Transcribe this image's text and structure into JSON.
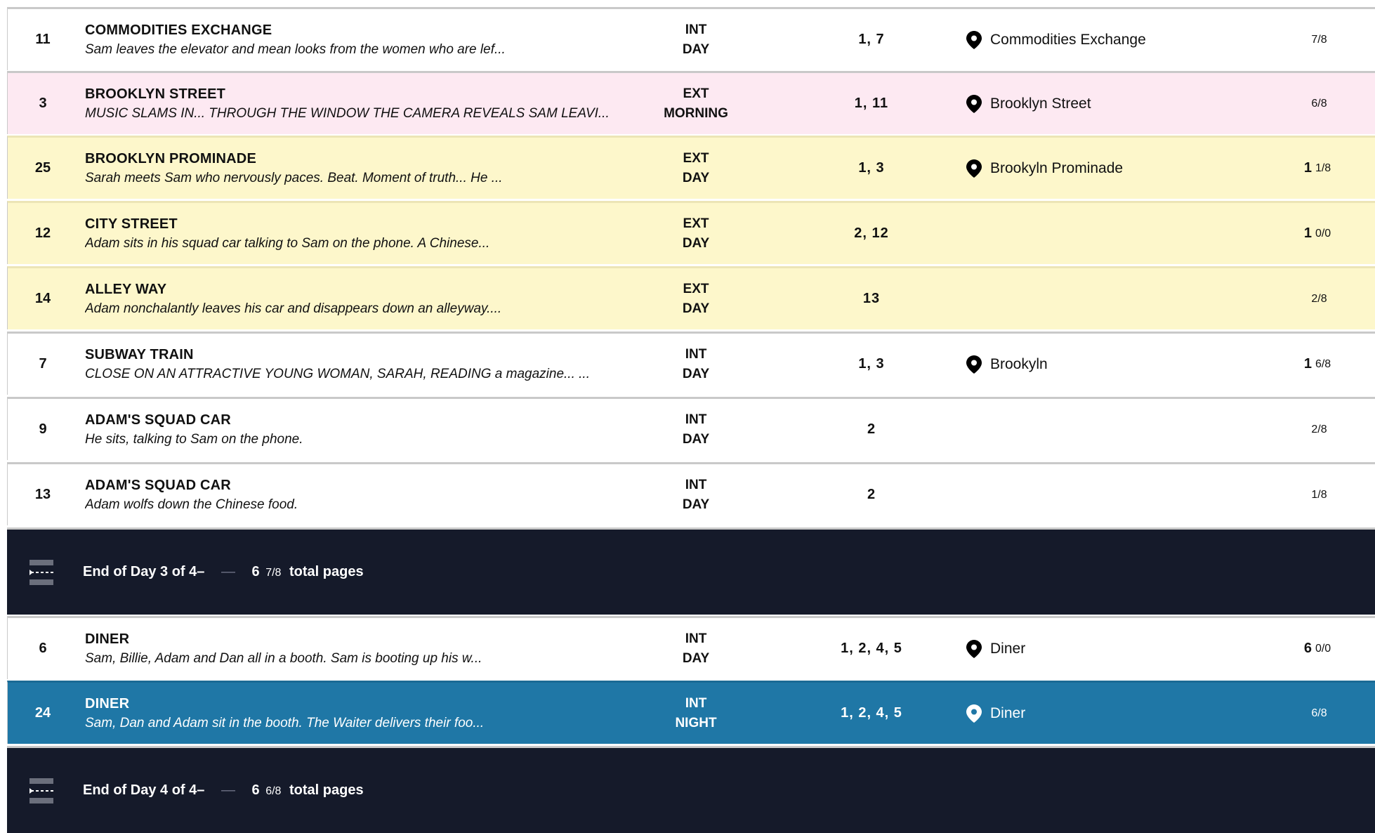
{
  "strips": [
    {
      "scene": "11",
      "heading": "COMMODITIES EXCHANGE",
      "synopsis": "Sam leaves the elevator and mean looks from the women who are lef...",
      "int_ext": "INT",
      "time": "DAY",
      "cast": "1, 7",
      "location": "Commodities Exchange",
      "pages_whole": "",
      "pages_frac": "7/8",
      "color": "white"
    },
    {
      "scene": "3",
      "heading": "BROOKLYN STREET",
      "synopsis": "MUSIC SLAMS IN... THROUGH THE WINDOW THE CAMERA REVEALS SAM LEAVI...",
      "int_ext": "EXT",
      "time": "MORNING",
      "cast": "1, 11",
      "location": "Brooklyn Street",
      "pages_whole": "",
      "pages_frac": "6/8",
      "color": "pink"
    },
    {
      "scene": "25",
      "heading": "BROOKLYN PROMINADE",
      "synopsis": "Sarah meets Sam who nervously paces. Beat. Moment of truth... He ...",
      "int_ext": "EXT",
      "time": "DAY",
      "cast": "1, 3",
      "location": "Brookyln Prominade",
      "pages_whole": "1",
      "pages_frac": "1/8",
      "color": "yellow"
    },
    {
      "scene": "12",
      "heading": "CITY STREET",
      "synopsis": "Adam sits in his squad car talking to Sam on the phone. A Chinese...",
      "int_ext": "EXT",
      "time": "DAY",
      "cast": "2, 12",
      "location": "",
      "pages_whole": "1",
      "pages_frac": "0/0",
      "color": "yellow"
    },
    {
      "scene": "14",
      "heading": "ALLEY WAY",
      "synopsis": "Adam nonchalantly leaves his car and disappears down an alleyway....",
      "int_ext": "EXT",
      "time": "DAY",
      "cast": "13",
      "location": "",
      "pages_whole": "",
      "pages_frac": "2/8",
      "color": "yellow"
    },
    {
      "scene": "7",
      "heading": "SUBWAY TRAIN",
      "synopsis": "CLOSE ON AN ATTRACTIVE YOUNG WOMAN, SARAH, READING a magazine... ...",
      "int_ext": "INT",
      "time": "DAY",
      "cast": "1, 3",
      "location": "Brookyln",
      "pages_whole": "1",
      "pages_frac": "6/8",
      "color": "white"
    },
    {
      "scene": "9",
      "heading": "ADAM'S SQUAD CAR",
      "synopsis": "He sits, talking to Sam on the phone.",
      "int_ext": "INT",
      "time": "DAY",
      "cast": "2",
      "location": "",
      "pages_whole": "",
      "pages_frac": "2/8",
      "color": "white"
    },
    {
      "scene": "13",
      "heading": "ADAM'S SQUAD CAR",
      "synopsis": "Adam wolfs down the Chinese food.",
      "int_ext": "INT",
      "time": "DAY",
      "cast": "2",
      "location": "",
      "pages_whole": "",
      "pages_frac": "1/8",
      "color": "white"
    }
  ],
  "day_break_1": {
    "label": "End of  Day 3 of 4–",
    "dash": "—",
    "pages_whole": "6",
    "pages_frac": "7/8",
    "pages_label": "total pages"
  },
  "strips_2": [
    {
      "scene": "6",
      "heading": "DINER",
      "synopsis": "Sam, Billie, Adam and Dan all in a booth. Sam is booting up his w...",
      "int_ext": "INT",
      "time": "DAY",
      "cast": "1, 2, 4, 5",
      "location": "Diner",
      "pages_whole": "6",
      "pages_frac": "0/0",
      "color": "white"
    },
    {
      "scene": "24",
      "heading": "DINER",
      "synopsis": "Sam, Dan and Adam sit in the booth. The Waiter delivers their foo...",
      "int_ext": "INT",
      "time": "NIGHT",
      "cast": "1, 2, 4, 5",
      "location": "Diner",
      "pages_whole": "",
      "pages_frac": "6/8",
      "color": "selected"
    }
  ],
  "day_break_2": {
    "label": "End of  Day 4 of 4–",
    "dash": "—",
    "pages_whole": "6",
    "pages_frac": "6/8",
    "pages_label": "total pages"
  },
  "icons": {
    "location": "map-pin-icon",
    "day_break": "day-break-icon"
  },
  "colors": {
    "pink": "#fde9f2",
    "yellow": "#fdf7cb",
    "selected": "#1f77a6",
    "day_break": "#151a2a"
  }
}
